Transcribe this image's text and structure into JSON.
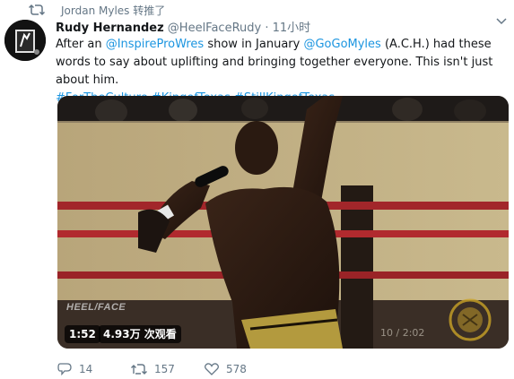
{
  "retweet_context": {
    "text": "Jordan Myles 转推了",
    "icon": "retweet-icon"
  },
  "tweet": {
    "author_name": "Rudy Hernandez",
    "handle": "@HeelFaceRudy",
    "separator": "·",
    "time": "11小时",
    "text_parts": {
      "p1": "After an ",
      "m1": "@InspireProWres",
      "p2": " show in January ",
      "m2": "@GoGoMyles",
      "p3": " (A.C.H.) had these words to say about uplifting and bringing together everyone. This isn't just about him.",
      "h1": "#ForTheCulture",
      "h2": "#KingofTexas",
      "h3": "#StillKingofTexas"
    }
  },
  "video": {
    "duration": "1:52",
    "views": "4.93万 次观看",
    "watermark_left": "HEEL/FACE",
    "overlay_time": "10 / 2:02"
  },
  "actions": {
    "reply_count": "14",
    "retweet_count": "157",
    "like_count": "578"
  },
  "colors": {
    "link": "#1b95e0",
    "secondary": "#657786",
    "text": "#14171a"
  }
}
